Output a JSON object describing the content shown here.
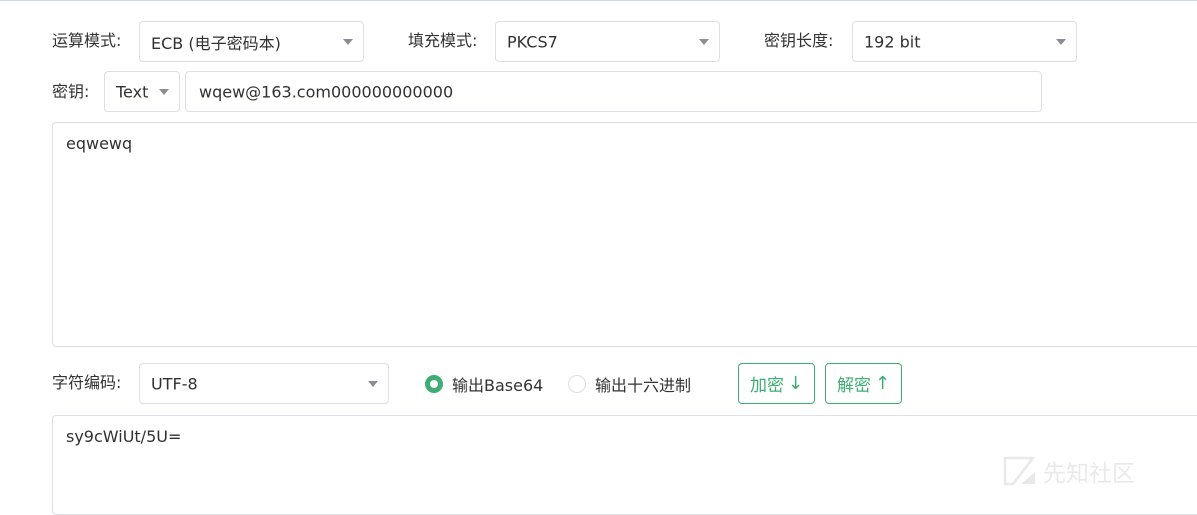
{
  "mode": {
    "label": "运算模式:",
    "value": "ECB (电子密码本)"
  },
  "padding": {
    "label": "填充模式:",
    "value": "PKCS7"
  },
  "key_length": {
    "label": "密钥长度:",
    "value": "192 bit"
  },
  "key": {
    "label": "密钥:",
    "format": "Text",
    "value": "wqew@163.com000000000000"
  },
  "input_text": "eqwewq",
  "charset": {
    "label": "字符编码:",
    "value": "UTF-8"
  },
  "output_options": [
    {
      "label": "输出Base64",
      "selected": true
    },
    {
      "label": "输出十六进制",
      "selected": false
    }
  ],
  "buttons": {
    "encrypt": "加密",
    "encrypt_arrow": "↓",
    "decrypt": "解密",
    "decrypt_arrow": "↑"
  },
  "output_text": "sy9cWiUt/5U=",
  "watermark": {
    "text": "先知社区"
  },
  "colors": {
    "accent": "#3dae72",
    "border": "#dcdfe6"
  }
}
